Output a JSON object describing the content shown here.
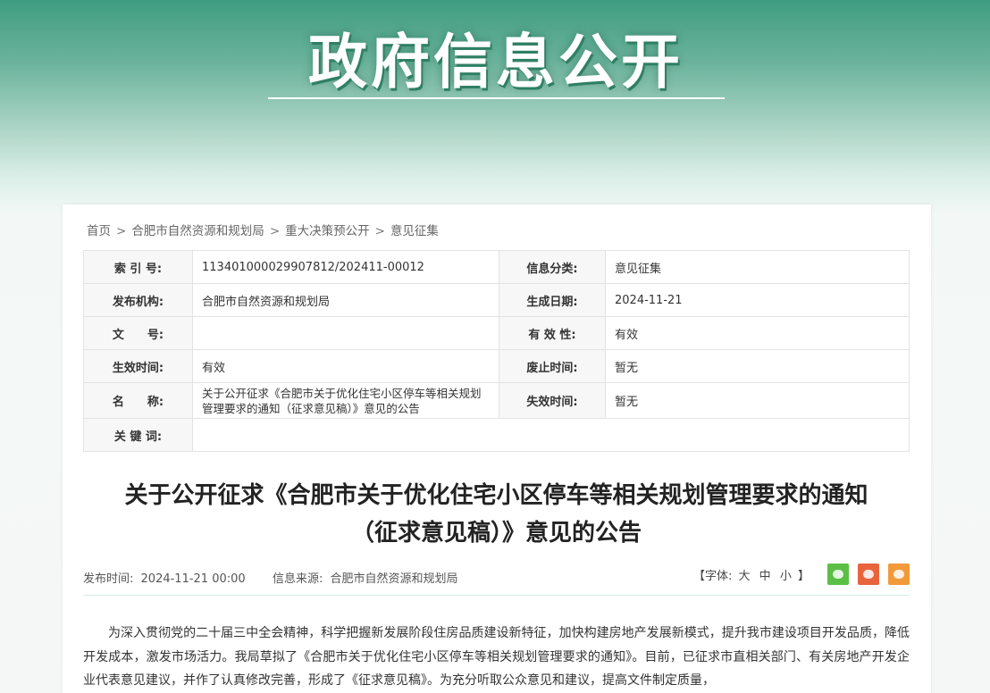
{
  "banner": {
    "title": "政府信息公开"
  },
  "breadcrumb": {
    "items": [
      "首页",
      "合肥市自然资源和规划局",
      "重大决策预公开",
      "意见征集"
    ],
    "separator": ">"
  },
  "meta": {
    "index_label": "索 引 号:",
    "index_value": "113401000029907812/202411-00012",
    "category_label": "信息分类:",
    "category_value": "意见征集",
    "publisher_label": "发布机构:",
    "publisher_value": "合肥市自然资源和规划局",
    "created_label": "生成日期:",
    "created_value": "2024-11-21",
    "docno_label": "文　　号:",
    "docno_value": "",
    "validity_label": "有 效 性:",
    "validity_value": "有效",
    "effective_label": "生效时间:",
    "effective_value": "有效",
    "repeal_label": "废止时间:",
    "repeal_value": "暂无",
    "name_label": "名　　称:",
    "name_value": "关于公开征求《合肥市关于优化住宅小区停车等相关规划管理要求的通知（征求意见稿）》意见的公告",
    "expire_label": "失效时间:",
    "expire_value": "暂无",
    "keywords_label": "关 键 词:",
    "keywords_value": ""
  },
  "article": {
    "title_line1": "关于公开征求《合肥市关于优化住宅小区停车等相关规划管理要求的通知",
    "title_line2": "（征求意见稿）》意见的公告",
    "publish_label": "发布时间:",
    "publish_value": "2024-11-21 00:00",
    "source_label": "信息来源:",
    "source_value": "合肥市自然资源和规划局",
    "font_label": "【字体:",
    "font_large": "大",
    "font_medium": "中",
    "font_small": "小",
    "font_close": "】",
    "share_icons": [
      "wechat-icon",
      "weibo-icon",
      "qzone-icon"
    ],
    "body": "为深入贯彻党的二十届三中全会精神，科学把握新发展阶段住房品质建设新特征，加快构建房地产发展新模式，提升我市建设项目开发品质，降低开发成本，激发市场活力。我局草拟了《合肥市关于优化住宅小区停车等相关规划管理要求的通知》。目前，已征求市直相关部门、有关房地产开发企业代表意见建议，并作了认真修改完善，形成了《征求意见稿》。为充分听取公众意见和建议，提高文件制定质量，"
  },
  "colors": {
    "banner_green": "#3f9c80",
    "wechat": "#5bbf45",
    "weibo": "#e8643d",
    "qzone": "#f29a3a"
  }
}
